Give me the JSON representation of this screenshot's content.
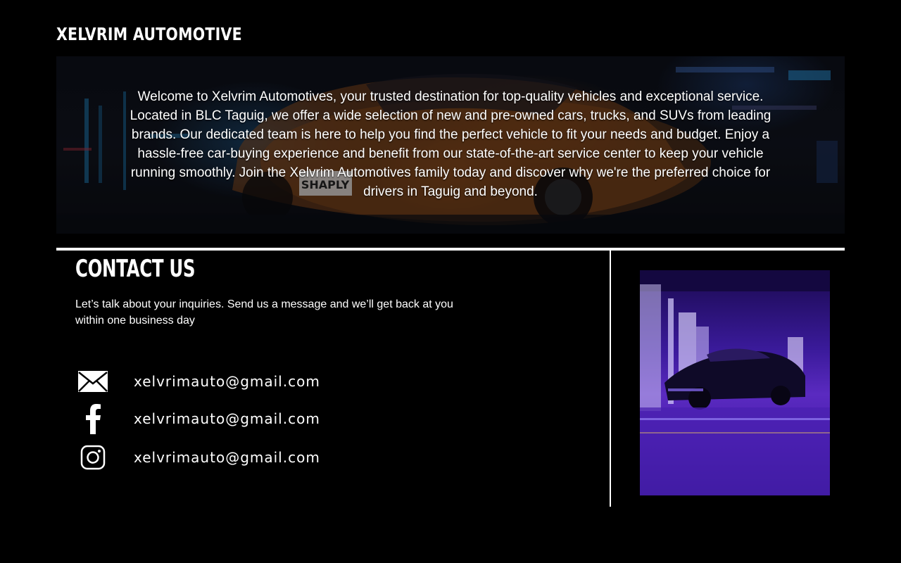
{
  "brand": {
    "name": "XELVRIM AUTOMOTIVE"
  },
  "hero": {
    "text": "Welcome to Xelvrim Automotives, your trusted destination for top-quality vehicles and exceptional service. Located in BLC Taguig, we offer a wide selection of new and pre-owned cars, trucks, and SUVs from leading brands. Our dedicated team is here to help you find the perfect vehicle to fit your needs and budget. Enjoy a hassle-free car-buying experience and benefit from our state-of-the-art service center to keep your vehicle running smoothly. Join the Xelvrim Automotives family today and discover why we're the preferred choice for drivers in Taguig and beyond.",
    "plate_text": "SHAPLY"
  },
  "contact": {
    "title": "CONTACT US",
    "description": "Let’s talk about your inquiries. Send us a message and we’ll get back at you within one business day",
    "items": [
      {
        "icon": "mail-icon",
        "label": "xelvrimauto@gmail.com"
      },
      {
        "icon": "facebook-icon",
        "label": "xelvrimauto@gmail.com"
      },
      {
        "icon": "instagram-icon",
        "label": "xelvrimauto@gmail.com"
      }
    ]
  },
  "colors": {
    "background": "#000000",
    "text": "#ffffff",
    "accent_purple": "#5a2ac0"
  }
}
